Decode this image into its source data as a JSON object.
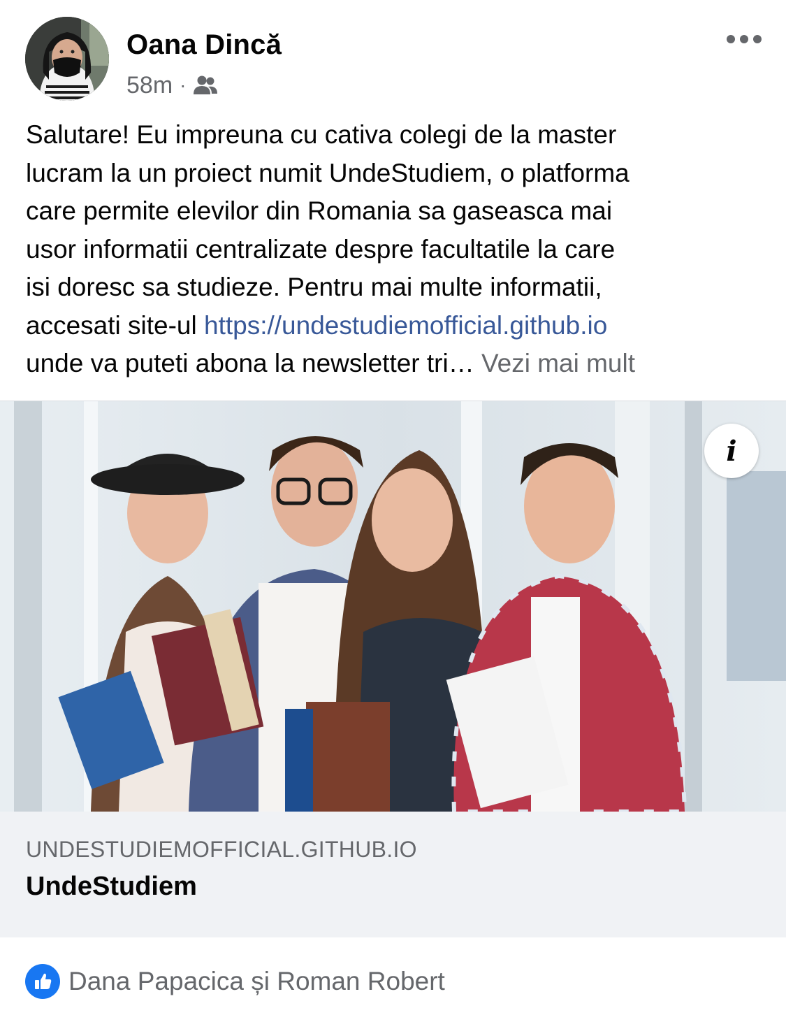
{
  "author": {
    "name": "Oana Dincă",
    "time": "58m",
    "separator": "·",
    "audience_icon": "friends-icon"
  },
  "post": {
    "lines": [
      "Salutare! Eu impreuna cu cativa colegi de la master",
      "lucram la un proiect numit UndeStudiem, o platforma",
      "care permite elevilor din Romania sa gaseasca mai",
      "usor informatii centralizate despre facultatile la care",
      "isi doresc sa studieze. Pentru mai multe informatii,"
    ],
    "link_prefix": "accesati site-ul ",
    "link_text": "https://undestudiemofficial.github.io",
    "last_line": "unde va puteti abona la newsletter tri… ",
    "see_more": "Vezi mai mult"
  },
  "link_preview": {
    "domain": "UNDESTUDIEMOFFICIAL.GITHUB.IO",
    "title": "UndeStudiem",
    "info_label": "i"
  },
  "reactions": {
    "icon": "like-icon",
    "names": "Dana Papacica și Roman Robert"
  },
  "colors": {
    "link": "#385898",
    "secondary_text": "#65676b",
    "like_blue": "#1877f2",
    "card_background": "#f0f2f5"
  }
}
